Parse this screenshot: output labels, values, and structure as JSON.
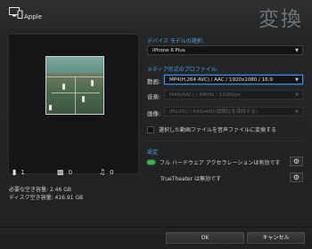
{
  "header": {
    "device_label": "Apple",
    "title": "変換"
  },
  "preview": {
    "counts": {
      "video": "1",
      "image": "0",
      "audio": "0"
    },
    "space": {
      "required": "必要な空き容量: 2.46 GB",
      "free": "ディスク空き容量: 416.91 GB"
    }
  },
  "device_section": {
    "heading": "デバイス モデルの選択:",
    "selected_model": "iPhone 6 Plus"
  },
  "media_section": {
    "heading": "メディア形式のプロファイル:",
    "video_label": "動画:",
    "video_value": "MP4(H.264 AVC) / AAC / 1920x1080 / 16:9",
    "audio_label": "音楽:",
    "audio_value": "M4A(AAC) / 48kHz / 192Kbps",
    "image_label": "画像:",
    "image_value": "JPG(PG) / 640x480(縦横比を保持する)",
    "checkbox_label": "選択した動画ファイルを音声ファイルに変換する"
  },
  "settings_section": {
    "heading": "設定",
    "hw_accel": "フル ハードウェア アクセラレーションは有効です",
    "truetheater": "TrueTheater は無効です"
  },
  "footer": {
    "ok": "OK",
    "cancel": "キャンセル"
  },
  "colors": {
    "accent": "#4da3e6",
    "status_on": "#3bb54a",
    "focus": "#3d8fe0"
  },
  "icons": {
    "device": "iphone-monitor-icon",
    "video_count": "film-strip-icon",
    "image_count": "picture-icon",
    "audio_count": "music-note-icon",
    "settings": "gear-icon",
    "dropdown": "chevron-down-icon"
  }
}
